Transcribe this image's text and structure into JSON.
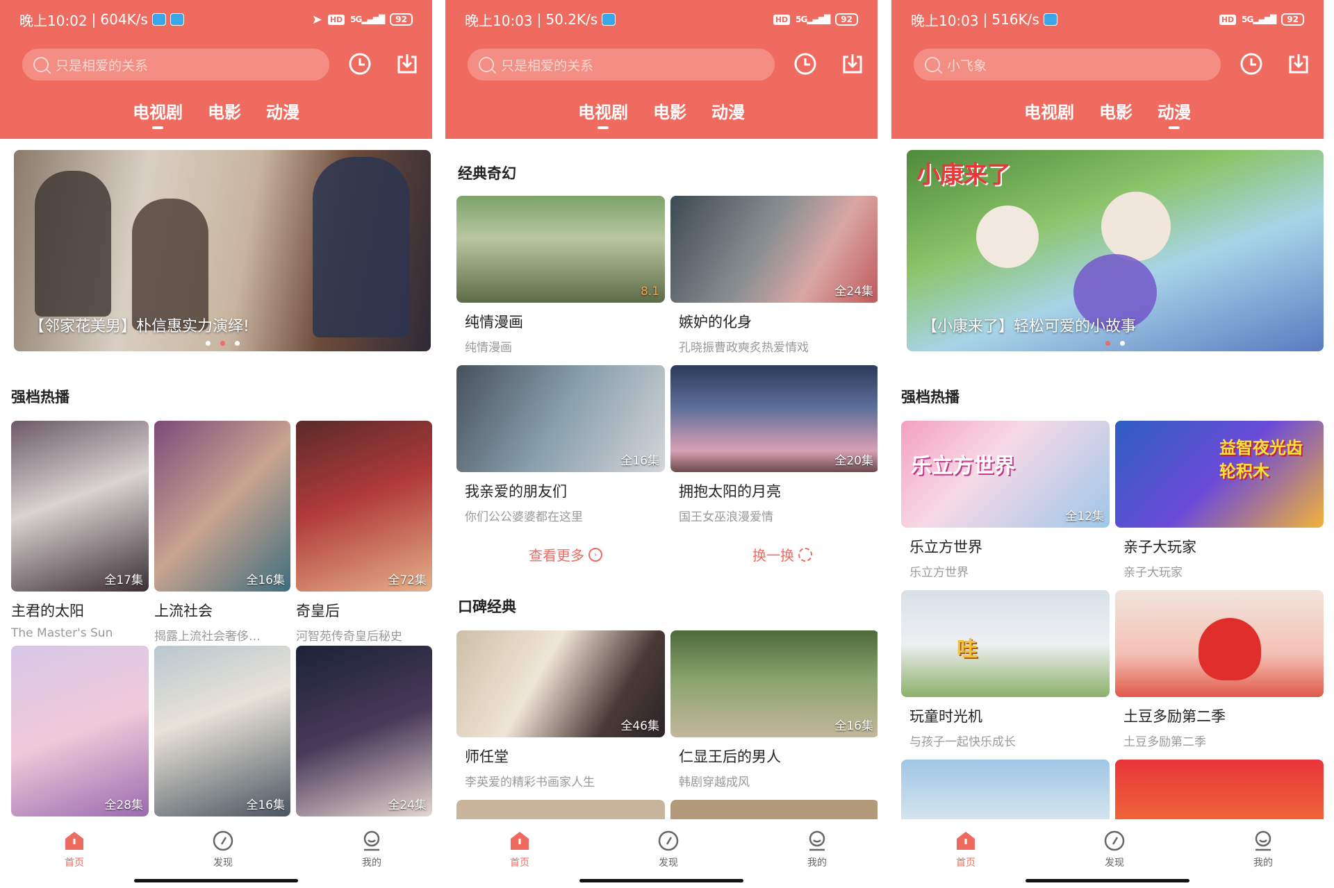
{
  "common": {
    "tabs": [
      "电视剧",
      "电影",
      "动漫"
    ],
    "bottom_nav": [
      "首页",
      "发现",
      "我的"
    ],
    "colors": {
      "accent": "#f06b5f",
      "search_bg": "#f48d84"
    }
  },
  "panels": [
    {
      "status": {
        "time": "晚上10:02",
        "speed": "604K/s",
        "battery": "92"
      },
      "search_placeholder": "只是相爱的关系",
      "active_tab": 0,
      "banner_caption": "【邻家花美男】朴信惠实力演绎!",
      "section_title": "强档热播",
      "cards": [
        {
          "title": "主君的太阳",
          "subtitle": "The Master's Sun",
          "badge": "全17集"
        },
        {
          "title": "上流社会",
          "subtitle": "揭露上流社会奢侈…",
          "badge": "全16集"
        },
        {
          "title": "奇皇后",
          "subtitle": "河智苑传奇皇后秘史",
          "badge": "全72集"
        },
        {
          "title": "",
          "subtitle": "",
          "badge": "全28集"
        },
        {
          "title": "",
          "subtitle": "",
          "badge": "全16集"
        },
        {
          "title": "",
          "subtitle": "",
          "badge": "全24集"
        }
      ]
    },
    {
      "status": {
        "time": "晚上10:03",
        "speed": "50.2K/s",
        "battery": "92"
      },
      "search_placeholder": "只是相爱的关系",
      "active_tab": 0,
      "section1_title": "经典奇幻",
      "section1_cards": [
        {
          "title": "纯情漫画",
          "subtitle": "纯情漫画",
          "badge": "8.1"
        },
        {
          "title": "嫉妒的化身",
          "subtitle": "孔晓振曹政奭炙热爱情戏",
          "badge": "全24集"
        },
        {
          "title": "我亲爱的朋友们",
          "subtitle": "你们公公婆婆都在这里",
          "badge": "全16集"
        },
        {
          "title": "拥抱太阳的月亮",
          "subtitle": "国王女巫浪漫爱情",
          "badge": "全20集"
        }
      ],
      "more_label": "查看更多",
      "refresh_label": "换一换",
      "section2_title": "口碑经典",
      "section2_cards": [
        {
          "title": "师任堂",
          "subtitle": "李英爱的精彩书画家人生",
          "badge": "全46集"
        },
        {
          "title": "仁显王后的男人",
          "subtitle": "韩剧穿越成风",
          "badge": "全16集"
        }
      ]
    },
    {
      "status": {
        "time": "晚上10:03",
        "speed": "516K/s",
        "battery": "92"
      },
      "search_placeholder": "小飞象",
      "active_tab": 2,
      "banner_caption": "【小康来了】轻松可爱的小故事",
      "banner_logo": "小康来了",
      "section_title": "强档热播",
      "cards": [
        {
          "title": "乐立方世界",
          "subtitle": "乐立方世界",
          "badge": "全12集",
          "art": "乐立方世界"
        },
        {
          "title": "亲子大玩家",
          "subtitle": "亲子大玩家",
          "badge": "",
          "art": "益智夜光齿轮积木"
        },
        {
          "title": "玩童时光机",
          "subtitle": "与孩子一起快乐成长",
          "badge": "",
          "art": "哇"
        },
        {
          "title": "土豆多励第二季",
          "subtitle": "土豆多励第二季",
          "badge": "",
          "art": ""
        }
      ]
    }
  ]
}
